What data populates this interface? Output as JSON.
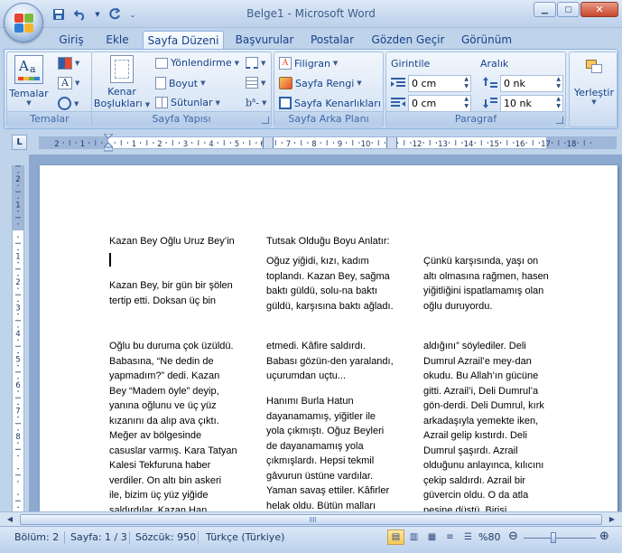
{
  "window": {
    "title": "Belge1 - Microsoft Word",
    "controls": {
      "minimize": "▁",
      "maximize": "▢",
      "close": "✕"
    }
  },
  "qat": {
    "save_icon": "save-icon",
    "undo_icon": "undo-icon",
    "redo_icon": "redo-icon"
  },
  "tabs": [
    {
      "label": "Giriş"
    },
    {
      "label": "Ekle"
    },
    {
      "label": "Sayfa Düzeni",
      "active": true
    },
    {
      "label": "Başvurular"
    },
    {
      "label": "Postalar"
    },
    {
      "label": "Gözden Geçir"
    },
    {
      "label": "Görünüm"
    }
  ],
  "ribbon": {
    "temalar": {
      "button": "Temalar",
      "group": "Temalar"
    },
    "sayfa_yapisi": {
      "group": "Sayfa Yapısı",
      "kenar_line1": "Kenar",
      "kenar_line2": "Boşlukları",
      "yonlendirme": "Yönlendirme",
      "boyut": "Boyut",
      "sutunlar": "Sütunlar"
    },
    "sayfa_arka_plani": {
      "group": "Sayfa Arka Planı",
      "filigran": "Filigran",
      "sayfa_rengi": "Sayfa Rengi",
      "kenarliklar": "Sayfa Kenarlıkları"
    },
    "paragraf": {
      "group": "Paragraf",
      "girintile": "Girintile",
      "aralik": "Aralık",
      "left_indent": "0 cm",
      "right_indent": "0 cm",
      "space_before": "0 nk",
      "space_after": "10 nk"
    },
    "yerlestir": {
      "button": "Yerleştir"
    }
  },
  "ruler": {
    "button": "L",
    "h_labels": [
      "2",
      "1",
      "1",
      "2",
      "3",
      "4",
      "5",
      "6",
      "7",
      "8",
      "9",
      "10",
      "11",
      "12",
      "13",
      "14",
      "15",
      "16",
      "17",
      "18"
    ],
    "v_labels": [
      "2",
      "1",
      "1",
      "2",
      "3",
      "4",
      "5",
      "6",
      "7",
      "8"
    ]
  },
  "document": {
    "col1_top": [
      "Kazan Bey Oğlu Uruz Bey’in"
    ],
    "col1_mid": [
      "Kazan Bey, bir gün bir şölen",
      "tertip etti. Doksan üç bin"
    ],
    "col1_bottom": [
      "Oğlu bu duruma çok üzüldü.",
      "Babasına, “Ne dedin de",
      "yapmadım?” dedi. Kazan",
      "Bey “Madem öyle” deyip,",
      "yanına oğlunu ve üç yüz",
      "kızanını da alıp ava çıktı.",
      "Meğer av bölgesinde",
      "casuslar varmış. Kara Tatyan",
      "Kalesi Tekfuruna haber",
      "verdiler. On altı bin askeri",
      "ile, bizim üç yüz yiğide",
      "saldırdılar. Kazan Han"
    ],
    "col2_top": [
      "Tutsak Olduğu Boyu Anlatır:"
    ],
    "col2_mid": [
      "Oğuz yiğidi, kızı, kadım",
      "toplandı. Kazan Bey, sağma",
      "baktı güldü, solu-na baktı",
      "güldü, karşısına baktı ağladı."
    ],
    "col2_bottom": [
      "etmedi. Kâfire saldırdı.",
      "Babası gözün-den yaralandı,",
      "uçurumdan uçtu..."
    ],
    "col2_bottom2": [
      "Hanımı Burla Hatun",
      "dayanamamış, yiğitler ile",
      "yola çıkmıştı. Oğuz Beyleri",
      "de dayanamamış yola",
      "çıkmışlardı. Hepsi tekmil",
      "gâvurun üstüne vardılar.",
      "Yaman savaş ettiler. Kâfirler",
      "helak oldu. Bütün malları"
    ],
    "col3_mid": [
      "Çünkü karşısında, yaşı on",
      "altı olmasına rağmen, hasen",
      "yiğitliğini ispatlamamış olan",
      "oğlu duruyordu."
    ],
    "col3_bottom": [
      "aldığını” söylediler. Deli",
      "Dumrul Azrail’e mey-dan",
      "okudu. Bu Allah’ın gücüne",
      "gitti. Azrail’i, Deli Dumrul’a",
      "gön-derdi. Deli Dumrul, kırk",
      "arkadaşıyla yemekte iken,",
      "Azrail gelip kıstırdı. Deli",
      "Dumrul şaşırdı. Azrail",
      "olduğunu anlayınca, kılıcını",
      "çekip saldırdı. Azrail bir",
      "güvercin oldu. O da atla",
      "peşine düştü. Birisi"
    ]
  },
  "statusbar": {
    "bolum": "Bölüm: 2",
    "sayfa": "Sayfa: 1 / 3",
    "sozcuk": "Sözcük: 950",
    "dil": "Türkçe (Türkiye)",
    "zoom": "%80",
    "zoom_level_percent": 80
  },
  "colors": {
    "ribbon_text": "#15428b",
    "page": "#ffffff",
    "doc_bg": "#8da9cf"
  }
}
